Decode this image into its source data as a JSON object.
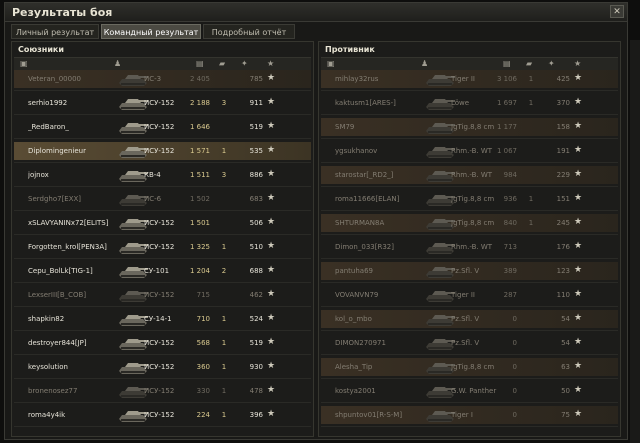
{
  "window": {
    "title": "Результаты боя"
  },
  "tabs": [
    {
      "label": "Личный результат",
      "active": false
    },
    {
      "label": "Командный результат",
      "active": true
    },
    {
      "label": "Подробный отчёт",
      "active": false
    }
  ],
  "allies": {
    "label": "Союзники",
    "rows": [
      {
        "name": "Veteran_00000",
        "tank": "ИС-3",
        "damage": "2 405",
        "kills": "",
        "xp": "785",
        "state": "dead"
      },
      {
        "name": "serhio1992",
        "tank": "ИСУ-152",
        "damage": "2 188",
        "kills": "3",
        "xp": "911",
        "state": "alive"
      },
      {
        "name": "_RedBaron_",
        "tank": "ИСУ-152",
        "damage": "1 646",
        "kills": "",
        "xp": "519",
        "state": "alive"
      },
      {
        "name": "Diplomingenieur",
        "tank": "ИСУ-152",
        "damage": "1 571",
        "kills": "1",
        "xp": "535",
        "state": "self"
      },
      {
        "name": "jojnox",
        "tank": "КВ-4",
        "damage": "1 511",
        "kills": "3",
        "xp": "886",
        "state": "alive"
      },
      {
        "name": "Serdgho7[EXX]",
        "tank": "ИС-6",
        "damage": "1 502",
        "kills": "",
        "xp": "683",
        "state": "dead"
      },
      {
        "name": "xSLAVYANINx72[ELITS]",
        "tank": "ИСУ-152",
        "damage": "1 501",
        "kills": "",
        "xp": "506",
        "state": "alive"
      },
      {
        "name": "Forgotten_krol[PEN3A]",
        "tank": "ИСУ-152",
        "damage": "1 325",
        "kills": "1",
        "xp": "510",
        "state": "alive"
      },
      {
        "name": "Cepu_BolLk[TIG-1]",
        "tank": "СУ-101",
        "damage": "1 204",
        "kills": "2",
        "xp": "688",
        "state": "alive"
      },
      {
        "name": "LexserIII[B_COB]",
        "tank": "ИСУ-152",
        "damage": "715",
        "kills": "",
        "xp": "462",
        "state": "dead"
      },
      {
        "name": "shapkin82",
        "tank": "СУ-14-1",
        "damage": "710",
        "kills": "1",
        "xp": "524",
        "state": "alive"
      },
      {
        "name": "destroyer844[JP]",
        "tank": "ИСУ-152",
        "damage": "568",
        "kills": "1",
        "xp": "519",
        "state": "alive"
      },
      {
        "name": "keysolution",
        "tank": "ИСУ-152",
        "damage": "360",
        "kills": "1",
        "xp": "930",
        "state": "alive"
      },
      {
        "name": "bronenosez77",
        "tank": "ИСУ-152",
        "damage": "330",
        "kills": "1",
        "xp": "478",
        "state": "dead"
      },
      {
        "name": "roma4y4ik",
        "tank": "ИСУ-152",
        "damage": "224",
        "kills": "1",
        "xp": "396",
        "state": "alive"
      }
    ]
  },
  "enemies": {
    "label": "Противник",
    "rows": [
      {
        "name": "mihlay32rus",
        "tank": "Tiger II",
        "damage": "3 106",
        "kills": "1",
        "xp": "425",
        "state": "dead"
      },
      {
        "name": "kaktusm1[ARES-]",
        "tank": "Löwe",
        "damage": "1 697",
        "kills": "1",
        "xp": "370",
        "state": "dead"
      },
      {
        "name": "SM79",
        "tank": "JgTig.8,8 cm",
        "damage": "1 177",
        "kills": "",
        "xp": "158",
        "state": "dead"
      },
      {
        "name": "ygsukhanov",
        "tank": "Rhm.-B. WT",
        "damage": "1 067",
        "kills": "",
        "xp": "191",
        "state": "dead"
      },
      {
        "name": "starostar[_RD2_]",
        "tank": "Rhm.-B. WT",
        "damage": "984",
        "kills": "",
        "xp": "229",
        "state": "dead"
      },
      {
        "name": "roma11666[ELAN]",
        "tank": "JgTig.8,8 cm",
        "damage": "936",
        "kills": "1",
        "xp": "151",
        "state": "dead"
      },
      {
        "name": "SHTURMAN8A",
        "tank": "JgTig.8,8 cm",
        "damage": "840",
        "kills": "1",
        "xp": "245",
        "state": "dead"
      },
      {
        "name": "Dimon_033[R32]",
        "tank": "Rhm.-B. WT",
        "damage": "713",
        "kills": "",
        "xp": "176",
        "state": "dead"
      },
      {
        "name": "pantuha69",
        "tank": "Pz.Sfl. V",
        "damage": "389",
        "kills": "",
        "xp": "123",
        "state": "dead"
      },
      {
        "name": "VOVANVN79",
        "tank": "Tiger II",
        "damage": "287",
        "kills": "",
        "xp": "110",
        "state": "dead"
      },
      {
        "name": "kol_o_mbo",
        "tank": "Pz.Sfl. V",
        "damage": "0",
        "kills": "",
        "xp": "54",
        "state": "dead"
      },
      {
        "name": "DIMON270971",
        "tank": "Pz.Sfl. V",
        "damage": "0",
        "kills": "",
        "xp": "54",
        "state": "dead"
      },
      {
        "name": "Alesha_Tip",
        "tank": "JgTig.8,8 cm",
        "damage": "0",
        "kills": "",
        "xp": "63",
        "state": "dead"
      },
      {
        "name": "kostya2001",
        "tank": "G.W. Panther",
        "damage": "0",
        "kills": "",
        "xp": "50",
        "state": "dead"
      },
      {
        "name": "shpuntov01[R-S-M]",
        "tank": "Tiger I",
        "damage": "0",
        "kills": "",
        "xp": "75",
        "state": "dead"
      }
    ]
  }
}
